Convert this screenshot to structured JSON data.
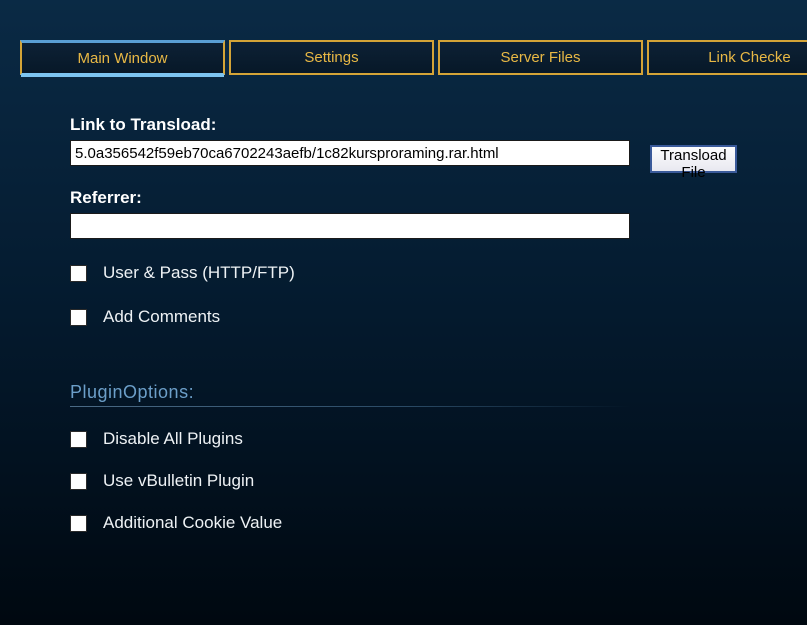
{
  "tabs": {
    "main_window": "Main Window",
    "settings": "Settings",
    "server_files": "Server Files",
    "link_checker": "Link Checke"
  },
  "form": {
    "link_label": "Link to Transload:",
    "link_value": "5.0a356542f59eb70ca6702243aefb/1c82kursproraming.rar.html",
    "referrer_label": "Referrer:",
    "referrer_value": "",
    "transload_button": "Transload File",
    "user_pass_label": "User & Pass (HTTP/FTP)",
    "add_comments_label": "Add Comments"
  },
  "plugin_section": {
    "title": "PluginOptions:",
    "disable_all_label": "Disable All Plugins",
    "vbulletin_label": "Use vBulletin Plugin",
    "cookie_label": "Additional Cookie Value"
  }
}
